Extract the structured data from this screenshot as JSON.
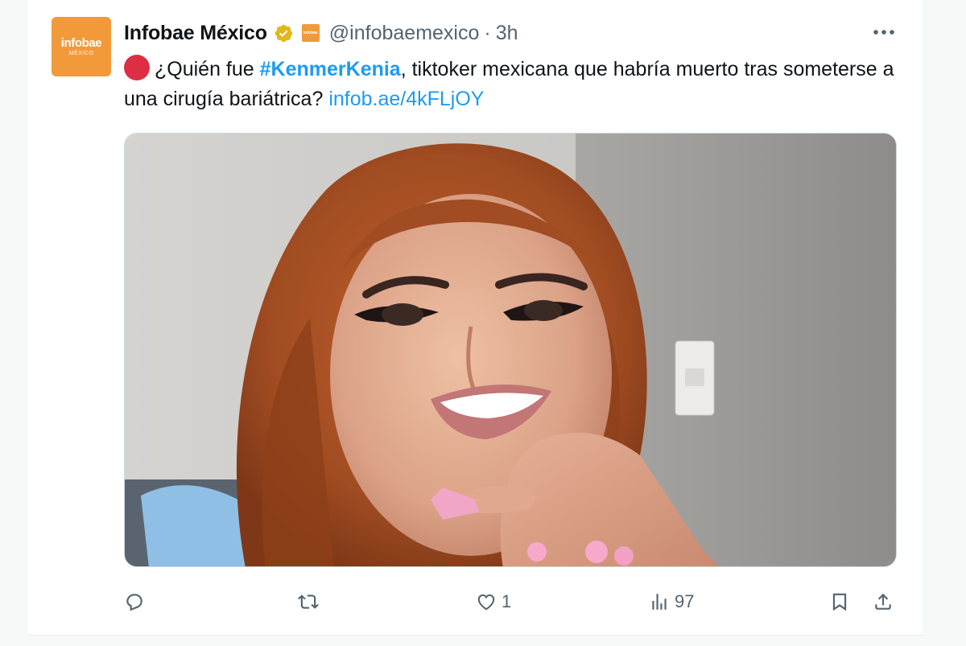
{
  "tweet": {
    "author": {
      "display_name": "Infobae México",
      "handle": "@infobaemexico",
      "separator": "·",
      "time": "3h",
      "avatar_brand": "infobae",
      "avatar_sub": "MÉXICO",
      "affiliate_badge_text": "infobae"
    },
    "text": {
      "prefix": "¿Quién fue ",
      "hashtag": "#KenmerKenia",
      "middle": ", tiktoker mexicana que habría muerto tras someterse a una cirugía bariátrica? ",
      "link": "infob.ae/4kFLjOY"
    },
    "media": {
      "description_icon": "photo"
    },
    "actions": {
      "reply_count": "",
      "retweet_count": "",
      "like_count": "1",
      "views_count": "97"
    },
    "icons": {
      "verified": "verified-badge-icon",
      "affiliate": "affiliate-badge-icon",
      "more": "more-icon",
      "reply": "reply-icon",
      "retweet": "retweet-icon",
      "like": "heart-icon",
      "views": "views-icon",
      "bookmark": "bookmark-icon",
      "share": "share-icon"
    },
    "colors": {
      "link": "#1d9bf0",
      "text": "#0f1419",
      "muted": "#536471",
      "brand_orange": "#f29a3a",
      "verified_gold": "#e2b719",
      "emoji_red": "#dd2e44"
    }
  }
}
